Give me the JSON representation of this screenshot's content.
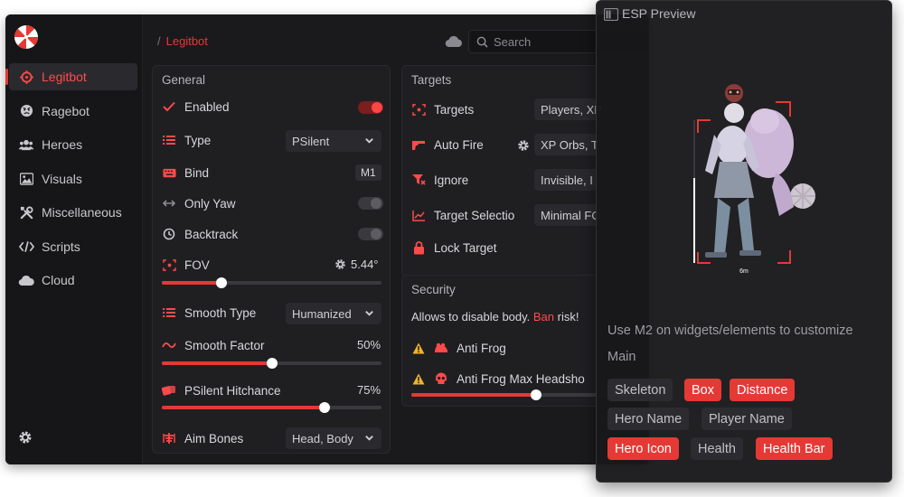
{
  "breadcrumb": {
    "sep": "/",
    "current": "Legitbot"
  },
  "search": {
    "placeholder": "Search"
  },
  "sidebar": {
    "items": [
      {
        "label": "Legitbot",
        "icon": "crosshair-icon",
        "active": true
      },
      {
        "label": "Ragebot",
        "icon": "angry-face-icon",
        "active": false
      },
      {
        "label": "Heroes",
        "icon": "users-icon",
        "active": false
      },
      {
        "label": "Visuals",
        "icon": "image-icon",
        "active": false
      },
      {
        "label": "Miscellaneous",
        "icon": "tools-icon",
        "active": false
      },
      {
        "label": "Scripts",
        "icon": "code-icon",
        "active": false
      },
      {
        "label": "Cloud",
        "icon": "cloud-icon",
        "active": false
      }
    ]
  },
  "general": {
    "title": "General",
    "enabled": {
      "label": "Enabled",
      "on": true
    },
    "type": {
      "label": "Type",
      "value": "PSilent"
    },
    "bind": {
      "label": "Bind",
      "value": "M1"
    },
    "only_yaw": {
      "label": "Only Yaw",
      "on": false
    },
    "backtrack": {
      "label": "Backtrack",
      "on": false
    },
    "fov": {
      "label": "FOV",
      "value": "5.44°",
      "fraction": 0.27
    },
    "smooth_type": {
      "label": "Smooth Type",
      "value": "Humanized"
    },
    "smooth_factor": {
      "label": "Smooth Factor",
      "value": "50%",
      "fraction": 0.5
    },
    "psilent_hitchance": {
      "label": "PSilent Hitchance",
      "value": "75%",
      "fraction": 0.74
    },
    "aim_bones": {
      "label": "Aim Bones",
      "value": "Head, Body"
    }
  },
  "targets": {
    "title": "Targets",
    "targets": {
      "label": "Targets",
      "value": "Players, XP"
    },
    "auto_fire": {
      "label": "Auto Fire",
      "value": "XP Orbs, T"
    },
    "ignore": {
      "label": "Ignore",
      "value": "Invisible, I"
    },
    "target_selection": {
      "label": "Target Selectio",
      "value": "Minimal FO"
    },
    "lock_target": {
      "label": "Lock Target"
    }
  },
  "security": {
    "title": "Security",
    "text_prefix": "Allows to disable body. ",
    "text_ban": "Ban",
    "text_suffix": " risk!",
    "anti_frog": {
      "label": "Anti Frog"
    },
    "anti_frog_headshot": {
      "label": "Anti Frog Max Headsho",
      "fraction": 0.6
    }
  },
  "esp": {
    "title": "ESP Preview",
    "distance_label": "6m",
    "hint": "Use M2 on widgets/elements to customize",
    "main_label": "Main",
    "chips": [
      {
        "label": "Skeleton",
        "active": false
      },
      {
        "label": "Box",
        "active": true
      },
      {
        "label": "Distance",
        "active": true
      },
      {
        "label": "Hero Name",
        "active": false
      },
      {
        "label": "Player Name",
        "active": false
      },
      {
        "label": "Hero Icon",
        "active": true
      },
      {
        "label": "Health",
        "active": false
      },
      {
        "label": "Health Bar",
        "active": true
      }
    ]
  },
  "colors": {
    "accent": "#e53935",
    "bg": "#1a1a1c",
    "panel": "#1f1f22"
  }
}
